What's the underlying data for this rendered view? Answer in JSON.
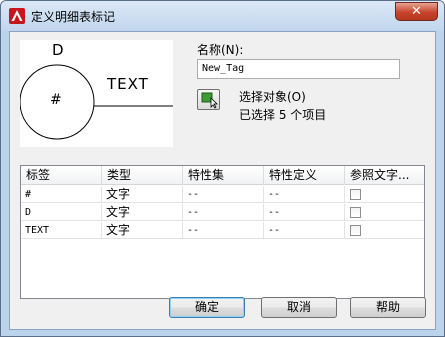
{
  "window": {
    "title": "定义明细表标记",
    "close_label": "✕"
  },
  "preview": {
    "label_d": "D",
    "label_text": "TEXT",
    "label_hash": "#"
  },
  "name": {
    "label": "名称(N):",
    "value": "New_Tag"
  },
  "select": {
    "label": "选择对象(O)",
    "status": "已选择 5 个项目"
  },
  "table": {
    "columns": [
      "标签",
      "类型",
      "特性集",
      "特性定义",
      "参照文字..."
    ],
    "rows": [
      {
        "tag": "#",
        "type": "文字",
        "set": "--",
        "def": "--"
      },
      {
        "tag": "D",
        "type": "文字",
        "set": "--",
        "def": "--"
      },
      {
        "tag": "TEXT",
        "type": "文字",
        "set": "--",
        "def": "--"
      }
    ]
  },
  "buttons": {
    "ok": "确定",
    "cancel": "取消",
    "help": "帮助"
  }
}
